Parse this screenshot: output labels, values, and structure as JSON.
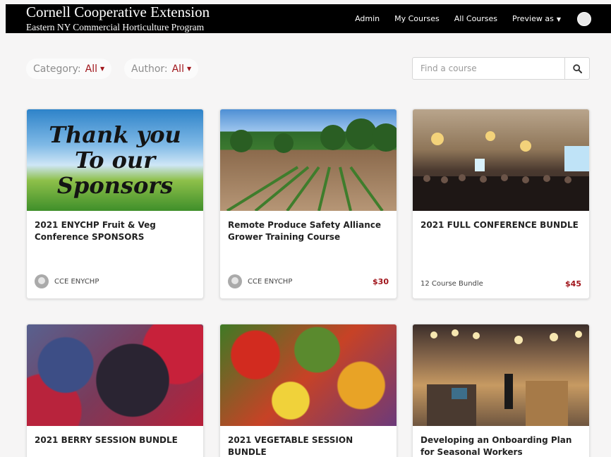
{
  "header": {
    "title": "Cornell Cooperative Extension",
    "subtitle": "Eastern NY Commercial Horticulture Program",
    "nav": {
      "admin": "Admin",
      "my_courses": "My Courses",
      "all_courses": "All Courses",
      "preview_as": "Preview as"
    }
  },
  "filters": {
    "category_label": "Category:",
    "category_value": "All",
    "author_label": "Author:",
    "author_value": "All"
  },
  "search": {
    "placeholder": "Find a course"
  },
  "courses": [
    {
      "title": "2021 ENYCHP Fruit & Veg Conference SPONSORS",
      "author": "CCE ENYCHP",
      "price": "",
      "image_text_1": "Thank you",
      "image_text_2": "To our",
      "image_text_3": "Sponsors"
    },
    {
      "title": "Remote Produce Safety Alliance Grower Training Course",
      "author": "CCE ENYCHP",
      "price": "$30"
    },
    {
      "title": "2021 FULL CONFERENCE BUNDLE",
      "bundle": "12 Course Bundle",
      "price": "$45"
    },
    {
      "title": "2021 BERRY SESSION BUNDLE"
    },
    {
      "title": "2021 VEGETABLE SESSION BUNDLE"
    },
    {
      "title": "Developing an Onboarding Plan for Seasonal Workers"
    }
  ],
  "colors": {
    "accent": "#a0151b",
    "header_bg": "#000000",
    "page_bg": "#f6f5f5"
  }
}
